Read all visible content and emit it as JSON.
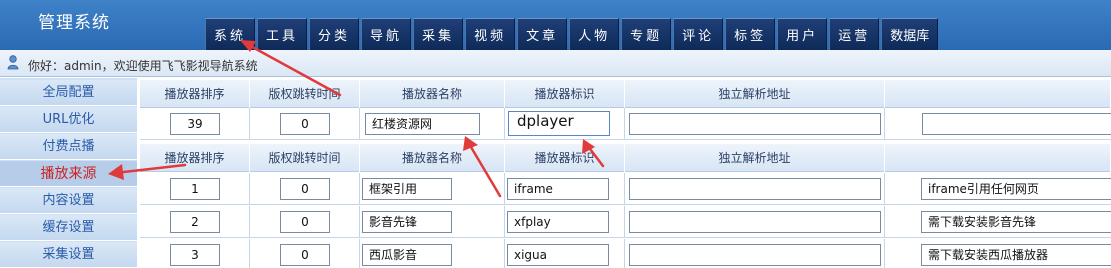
{
  "header": {
    "title": "管理系统"
  },
  "nav": [
    "系统",
    "工具",
    "分类",
    "导航",
    "采集",
    "视频",
    "文章",
    "人物",
    "专题",
    "评论",
    "标签",
    "用户",
    "运营",
    "数据库"
  ],
  "welcome": {
    "text": "你好：admin，欢迎使用飞飞影视导航系统"
  },
  "sidebar": {
    "items": [
      {
        "label": "全局配置"
      },
      {
        "label": "URL优化"
      },
      {
        "label": "付费点播"
      },
      {
        "label": "播放来源"
      },
      {
        "label": "内容设置"
      },
      {
        "label": "缓存设置"
      },
      {
        "label": "采集设置"
      }
    ]
  },
  "table": {
    "headers": [
      "播放器排序",
      "版权跳转时间",
      "播放器名称",
      "播放器标识",
      "独立解析地址"
    ],
    "new_row": {
      "order": "39",
      "jump_time": "0",
      "name": "红楼资源网",
      "code": "dplayer",
      "parse_url": "",
      "remark": ""
    },
    "rows": [
      {
        "order": "1",
        "jump_time": "0",
        "name": "框架引用",
        "code": "iframe",
        "parse_url": "",
        "remark": "iframe引用任何网页"
      },
      {
        "order": "2",
        "jump_time": "0",
        "name": "影音先锋",
        "code": "xfplay",
        "parse_url": "",
        "remark": "需下载安装影音先锋"
      },
      {
        "order": "3",
        "jump_time": "0",
        "name": "西瓜影音",
        "code": "xigua",
        "parse_url": "",
        "remark": "需下载安装西瓜播放器"
      }
    ]
  },
  "colors": {
    "header_blue": "#2a6ab3",
    "nav_dark": "#0f2a58",
    "active_red": "#cc2222",
    "arrow_red": "#e03a3a"
  }
}
